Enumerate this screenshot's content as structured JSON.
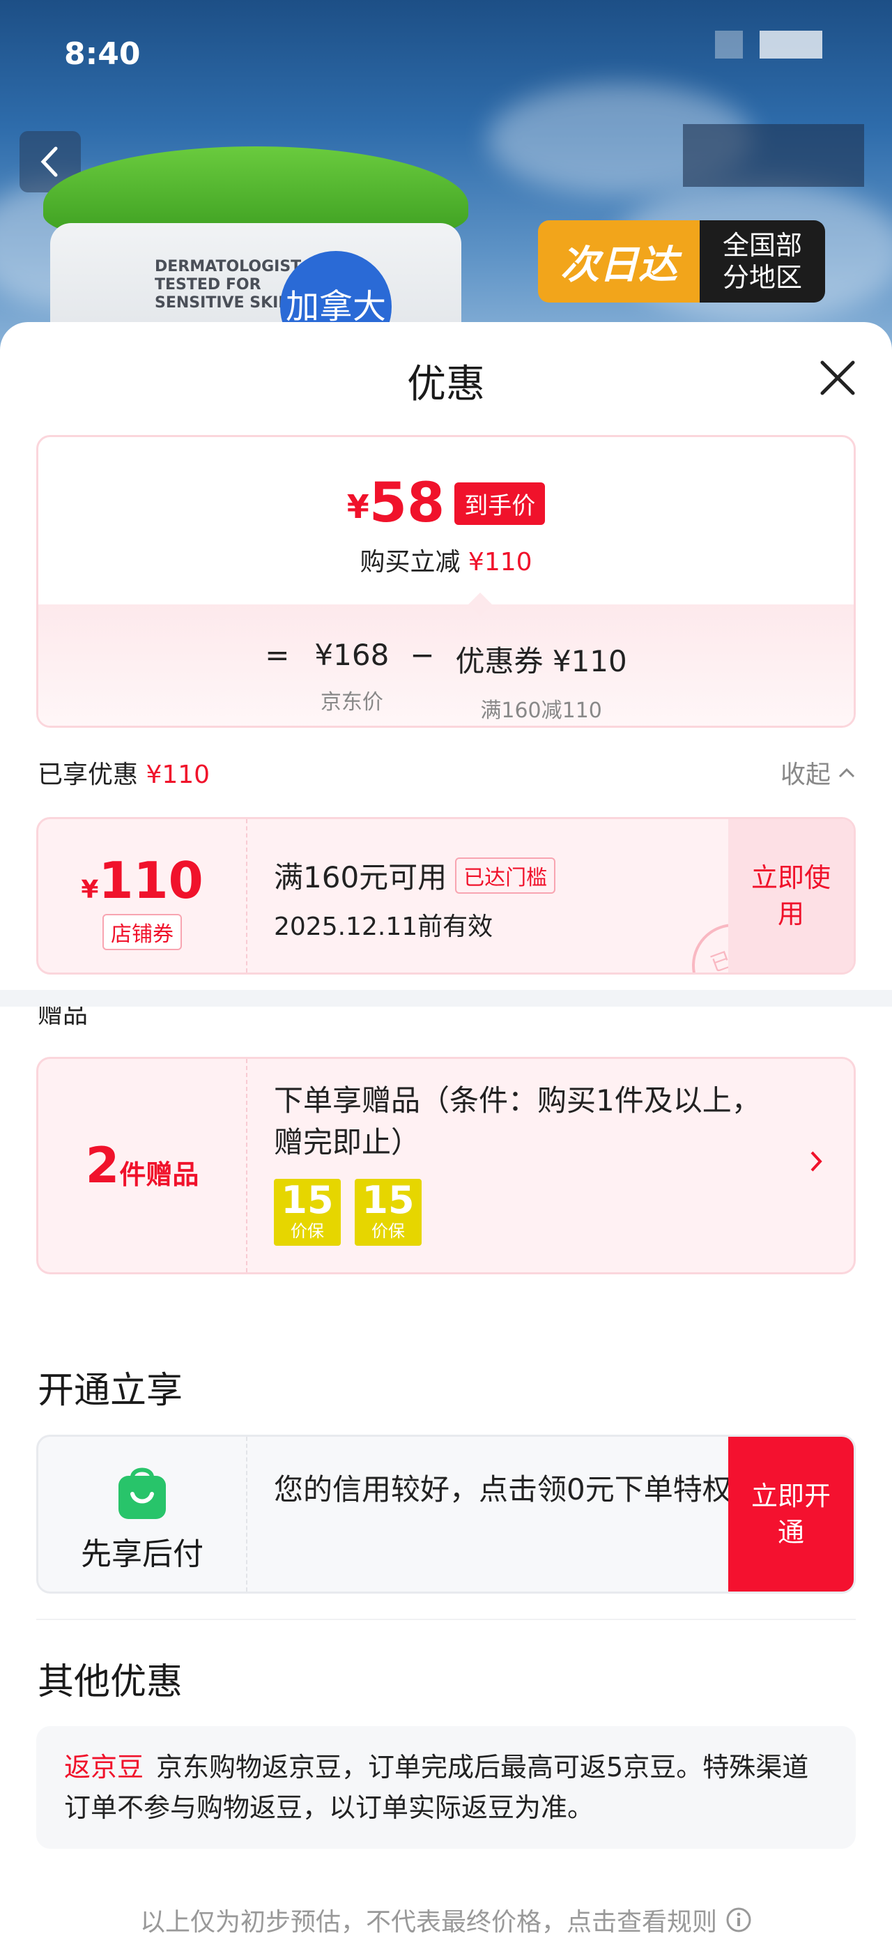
{
  "status_bar": {
    "time": "8:40"
  },
  "hero": {
    "jar_text": "DERMATOLOGIST TESTED FOR SENSITIVE SKIN",
    "jar_badge": "加拿大",
    "delivery_main": "次日达",
    "delivery_region": "全国部分地区"
  },
  "sheet": {
    "title": "优惠"
  },
  "price_card": {
    "symbol": "¥",
    "final_price": "58",
    "final_tag": "到手价",
    "reduce_label": "购买立减",
    "reduce_amount": "¥110",
    "formula": {
      "equals": "=",
      "jd_price": "¥168",
      "jd_price_label": "京东价",
      "minus": "−",
      "coupon": "优惠券 ¥110",
      "coupon_label": "满160减110"
    }
  },
  "enjoyed": {
    "label": "已享优惠",
    "amount": "¥110",
    "collapse": "收起"
  },
  "coupon": {
    "symbol": "¥",
    "amount": "110",
    "type": "店铺券",
    "condition": "满160元可用",
    "reached": "已达门槛",
    "validity": "2025.12.11前有效",
    "action": "立即使用",
    "stamp": "已领"
  },
  "gift": {
    "section_label": "赠品",
    "count": "2",
    "count_label": "件赠品",
    "description": "下单享赠品（条件：购买1件及以上，赠完即止）",
    "badges": [
      {
        "big": "15",
        "small": "价保"
      },
      {
        "big": "15",
        "small": "价保"
      }
    ]
  },
  "open_section": {
    "title": "开通立享",
    "product": "先享后付",
    "description": "您的信用较好，点击领0元下单特权",
    "action": "立即开通",
    "icon_color": "#28c46a"
  },
  "other": {
    "title": "其他优惠",
    "tag": "返京豆",
    "text": "京东购物返京豆，订单完成后最高可返5京豆。特殊渠道订单不参与购物返豆，以订单实际返豆为准。"
  },
  "footer": {
    "text": "以上仅为初步预估，不代表最终价格，点击查看规则"
  },
  "colors": {
    "accent": "#f0122b",
    "card_border": "#fbd6dc",
    "card_bg": "#fff1f3"
  }
}
